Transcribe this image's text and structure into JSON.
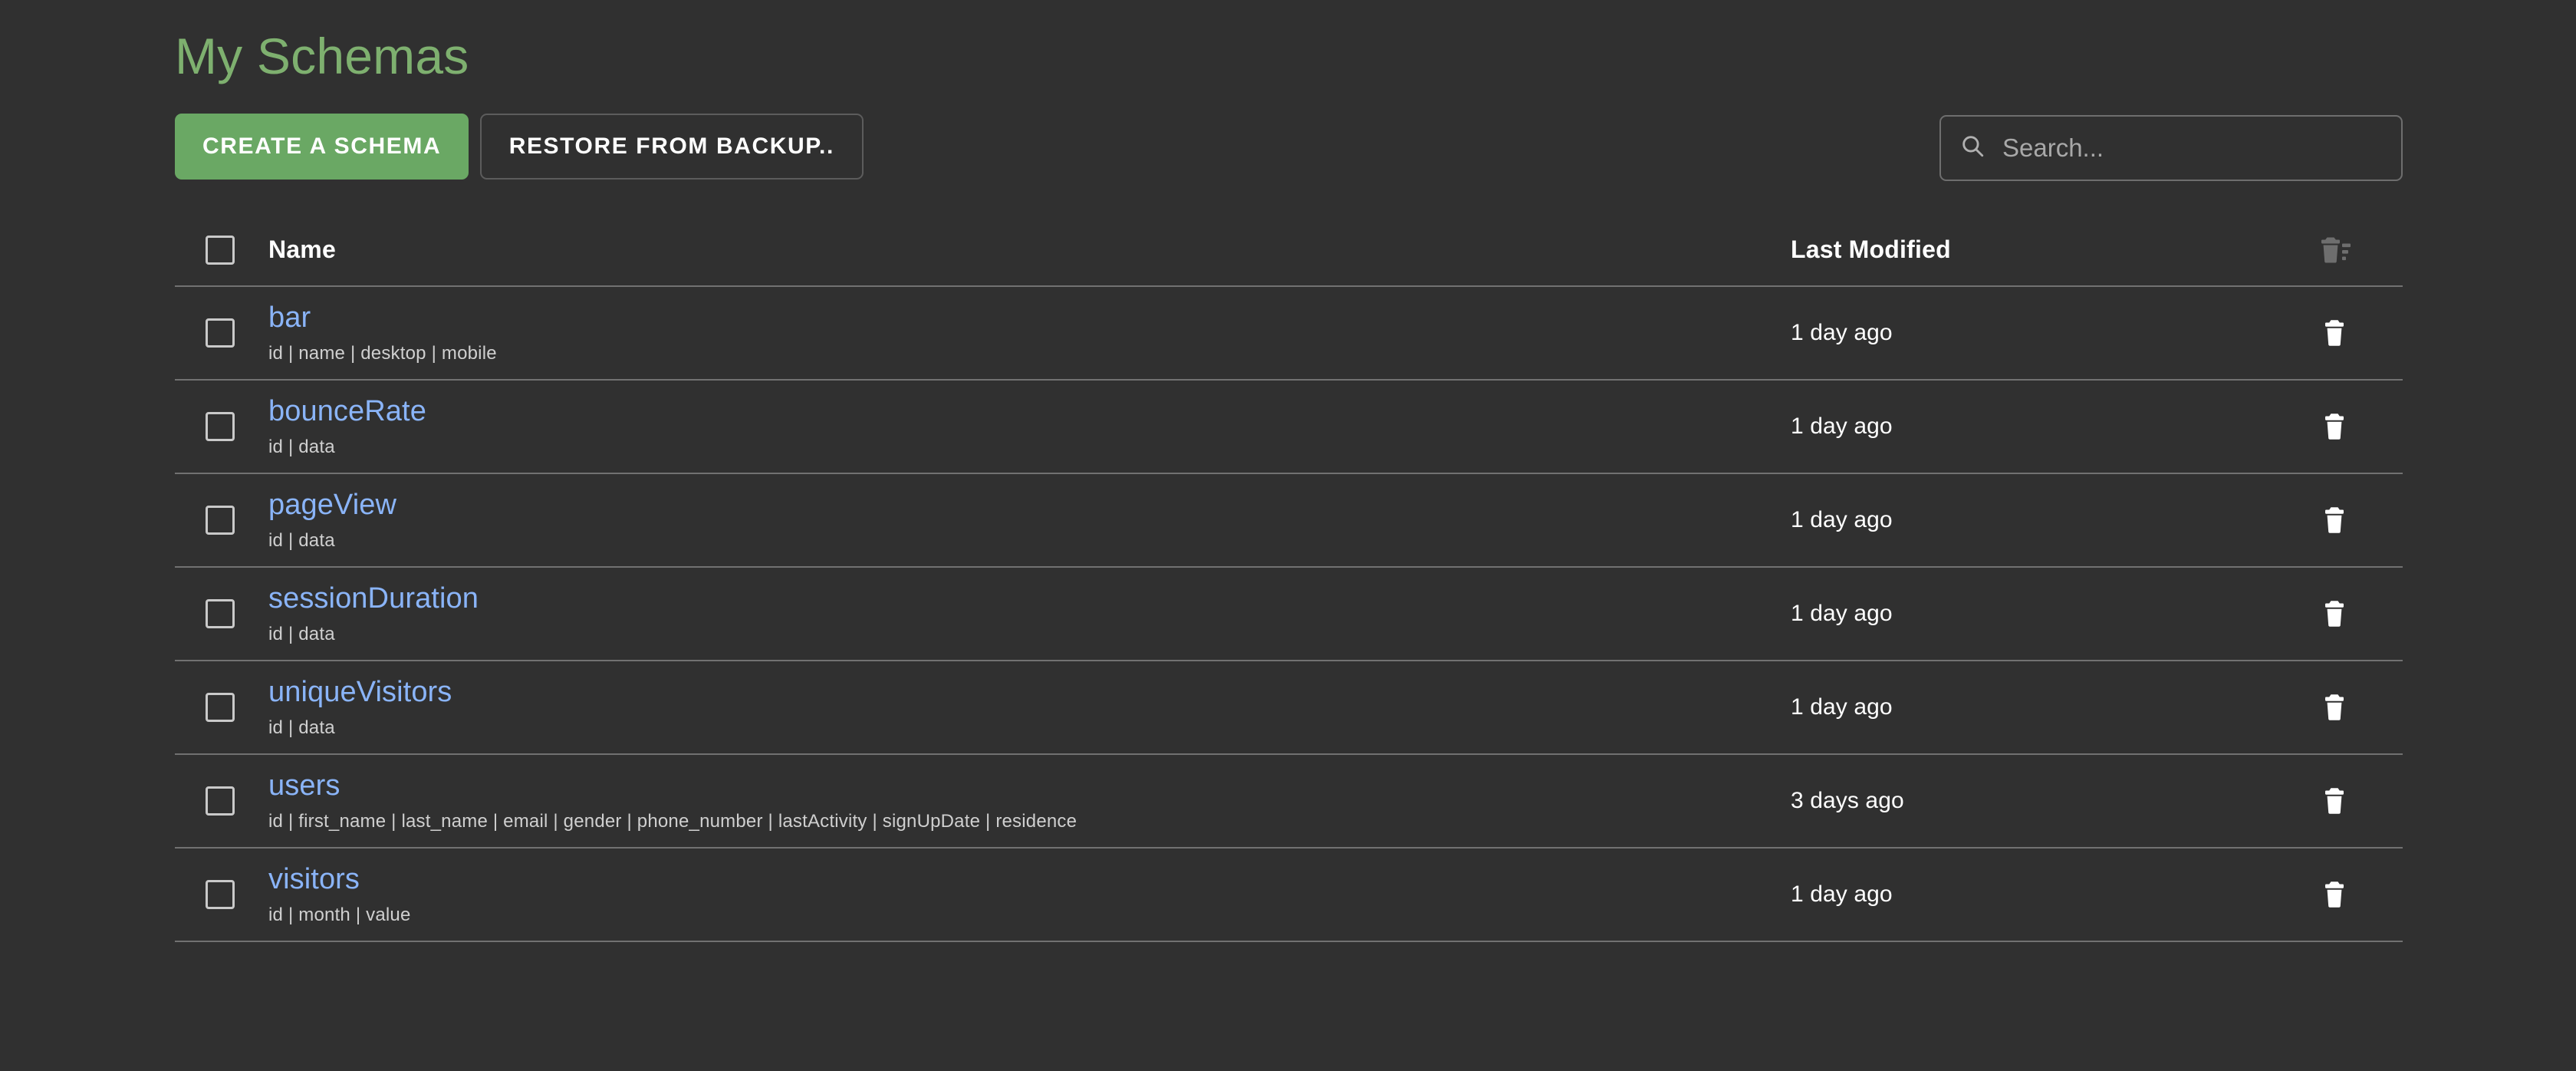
{
  "header": {
    "title": "My Schemas"
  },
  "toolbar": {
    "create_label": "CREATE A SCHEMA",
    "restore_label": "RESTORE FROM BACKUP..",
    "search": {
      "value": "",
      "placeholder": "Search..."
    }
  },
  "table": {
    "columns": {
      "name": "Name",
      "last_modified": "Last Modified",
      "actions": ""
    },
    "rows": [
      {
        "name": "bar",
        "fields": "id | name | desktop | mobile",
        "last_modified": "1 day ago"
      },
      {
        "name": "bounceRate",
        "fields": "id | data",
        "last_modified": "1 day ago"
      },
      {
        "name": "pageView",
        "fields": "id | data",
        "last_modified": "1 day ago"
      },
      {
        "name": "sessionDuration",
        "fields": "id | data",
        "last_modified": "1 day ago"
      },
      {
        "name": "uniqueVisitors",
        "fields": "id | data",
        "last_modified": "1 day ago"
      },
      {
        "name": "users",
        "fields": "id | first_name | last_name | email | gender | phone_number | lastActivity | signUpDate | residence",
        "last_modified": "3 days ago"
      },
      {
        "name": "visitors",
        "fields": "id | month | value",
        "last_modified": "1 day ago"
      }
    ]
  },
  "icons": {
    "search": "search-icon",
    "delete_selected": "delete-sweep-icon",
    "delete_row": "trash-icon",
    "checkbox": "checkbox-unchecked-icon"
  },
  "colors": {
    "background": "#303030",
    "title": "#7eb06f",
    "primary_button": "#6aa864",
    "link": "#8ab4f8",
    "divider": "#717171",
    "muted_text": "#cfcfcf"
  }
}
